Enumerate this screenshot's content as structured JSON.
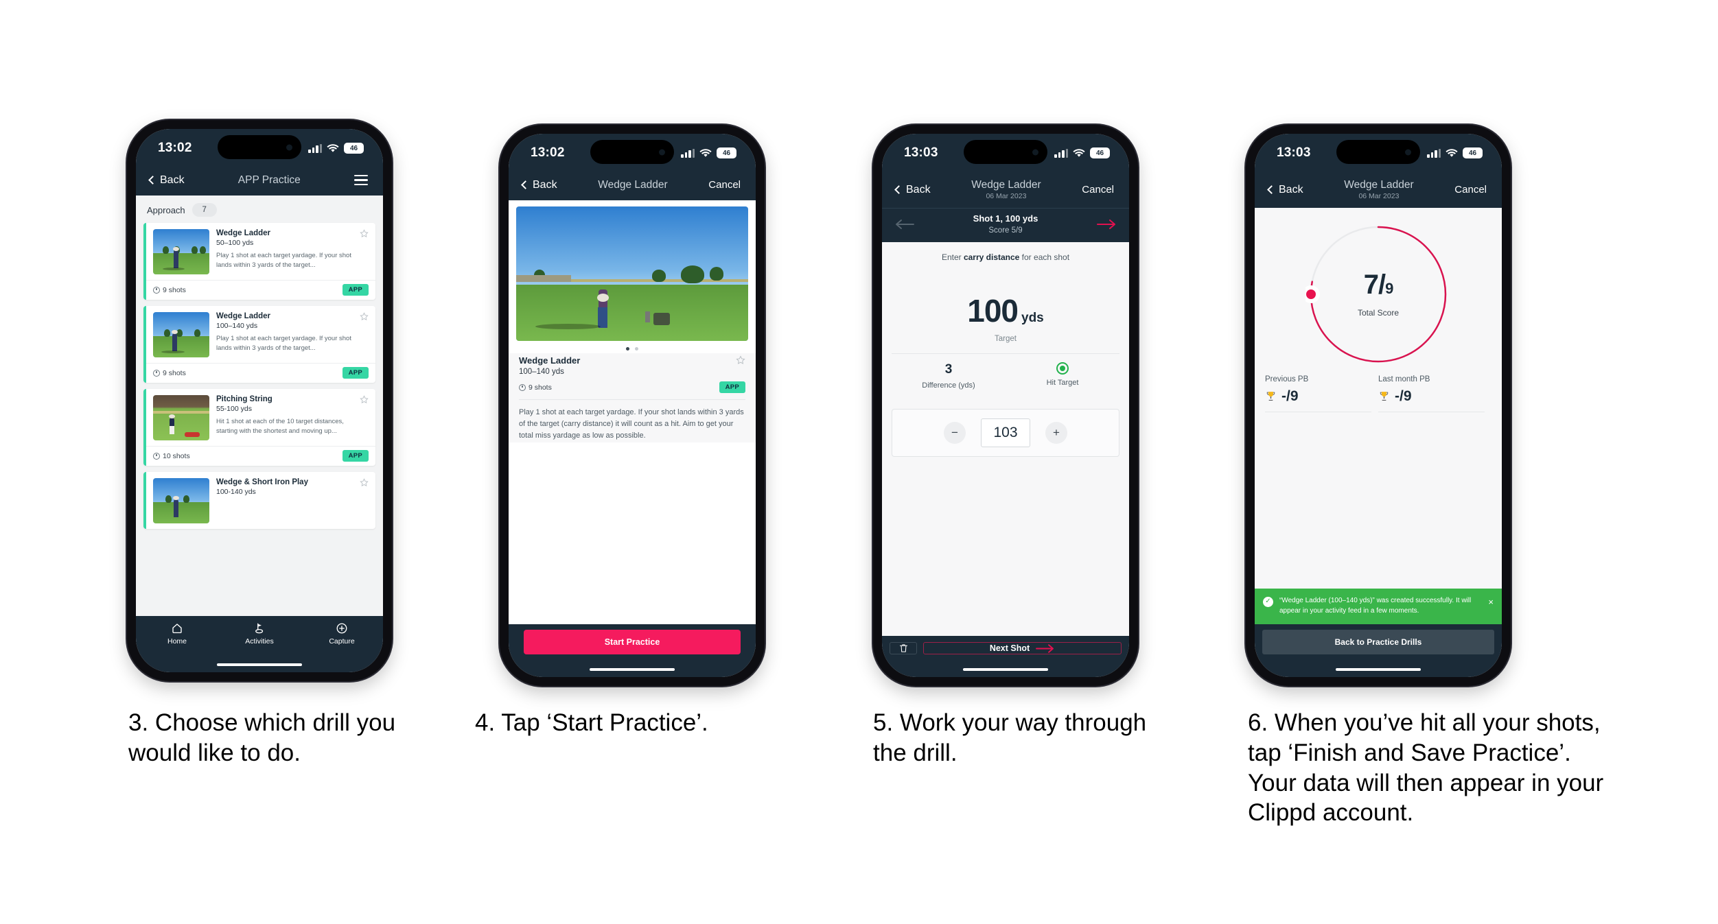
{
  "phones": [
    {
      "id": "phone-list",
      "status": {
        "time": "13:02",
        "battery": "46"
      },
      "nav": {
        "back": "Back",
        "title": "APP Practice",
        "menu": "menu-icon"
      },
      "category": {
        "name": "Approach",
        "count": "7"
      },
      "cards": [
        {
          "title": "Wedge Ladder",
          "yards": "50–100 yds",
          "desc": "Play 1 shot at each target yardage. If your shot lands within 3 yards of the target...",
          "shots": "9 shots",
          "tag": "APP"
        },
        {
          "title": "Wedge Ladder",
          "yards": "100–140 yds",
          "desc": "Play 1 shot at each target yardage. If your shot lands within 3 yards of the target...",
          "shots": "9 shots",
          "tag": "APP"
        },
        {
          "title": "Pitching String",
          "yards": "55-100 yds",
          "desc": "Hit 1 shot at each of the 10 target distances, starting with the shortest and moving up...",
          "shots": "10 shots",
          "tag": "APP"
        },
        {
          "title": "Wedge & Short Iron Play",
          "yards": "100-140 yds",
          "desc": "",
          "shots": "",
          "tag": ""
        }
      ],
      "tabs": [
        {
          "label": "Home",
          "icon": "home-icon"
        },
        {
          "label": "Activities",
          "icon": "golf-flag-icon"
        },
        {
          "label": "Capture",
          "icon": "plus-circle-icon"
        }
      ]
    },
    {
      "id": "phone-detail",
      "status": {
        "time": "13:02",
        "battery": "46"
      },
      "nav": {
        "back": "Back",
        "title": "Wedge Ladder",
        "cancel": "Cancel"
      },
      "detail": {
        "title": "Wedge Ladder",
        "yards": "100–140 yds",
        "shots": "9 shots",
        "tag": "APP",
        "description": "Play 1 shot at each target yardage. If your shot lands within 3 yards of the target (carry distance) it will count as a hit. Aim to get your total miss yardage as low as possible."
      },
      "cta": "Start Practice"
    },
    {
      "id": "phone-entry",
      "status": {
        "time": "13:03",
        "battery": "46"
      },
      "nav": {
        "back": "Back",
        "title": "Wedge Ladder",
        "subtitle": "06 Mar 2023",
        "cancel": "Cancel"
      },
      "shotbar": {
        "shot": "Shot 1, 100 yds",
        "score": "Score 5/9"
      },
      "hint_prefix": "Enter ",
      "hint_bold": "carry distance",
      "hint_suffix": " for each shot",
      "target": {
        "value": "100",
        "unit": "yds",
        "label": "Target"
      },
      "stats": [
        {
          "value": "3",
          "label": "Difference (yds)"
        },
        {
          "value": "",
          "label": "Hit Target"
        }
      ],
      "stepper": {
        "minus": "−",
        "value": "103",
        "plus": "+"
      },
      "footer": {
        "delete": "trash-icon",
        "next": "Next Shot"
      }
    },
    {
      "id": "phone-results",
      "status": {
        "time": "13:03",
        "battery": "46"
      },
      "nav": {
        "back": "Back",
        "title": "Wedge Ladder",
        "subtitle": "06 Mar 2023",
        "cancel": "Cancel"
      },
      "ring": {
        "score": "7",
        "slash": "/",
        "total": "9",
        "label": "Total Score",
        "percent": 78,
        "accent": "#d9134f"
      },
      "pbs": [
        {
          "label": "Previous PB",
          "value": "-/9"
        },
        {
          "label": "Last month PB",
          "value": "-/9"
        }
      ],
      "toast": {
        "message": "“Wedge Ladder (100–140 yds)” was created successfully. It will appear in your activity feed in a few moments.",
        "close": "×"
      },
      "back_button": "Back to Practice Drills"
    }
  ],
  "captions": [
    "3. Choose which drill you would like to do.",
    "4. Tap ‘Start Practice’.",
    "5. Work your way through the drill.",
    "6. When you’ve hit all your shots, tap ‘Finish and Save Practice’. Your data will then appear in your Clippd account."
  ],
  "colors": {
    "dark": "#1b2b38",
    "accent_pink": "#f51b5e",
    "accent_crimson": "#d9134f",
    "mint": "#35d6a4",
    "green": "#3ab54a"
  }
}
